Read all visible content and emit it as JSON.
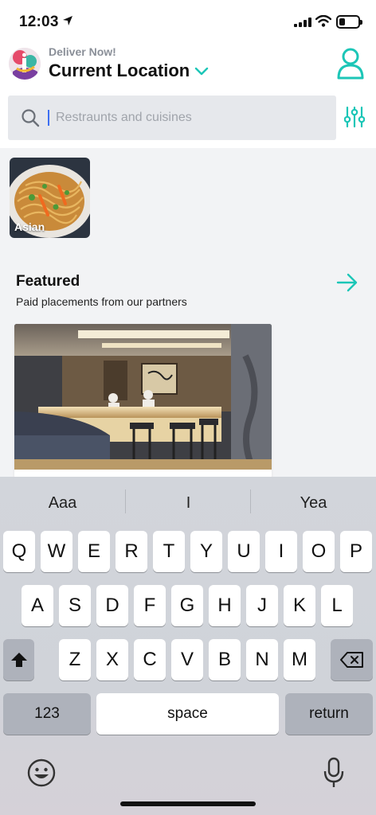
{
  "status": {
    "time": "12:03",
    "battery_level": 0.3
  },
  "header": {
    "deliver_label": "Deliver Now!",
    "location_title": "Current Location"
  },
  "search": {
    "placeholder": "Restraunts and cuisines",
    "value": ""
  },
  "categories": [
    {
      "label": "Asian"
    }
  ],
  "featured": {
    "title": "Featured",
    "subtitle": "Paid placements from our partners"
  },
  "keyboard": {
    "suggestions": [
      "Aaa",
      "I",
      "Yea"
    ],
    "row1": [
      "Q",
      "W",
      "E",
      "R",
      "T",
      "Y",
      "U",
      "I",
      "O",
      "P"
    ],
    "row2": [
      "A",
      "S",
      "D",
      "F",
      "G",
      "H",
      "J",
      "K",
      "L"
    ],
    "row3": [
      "Z",
      "X",
      "C",
      "V",
      "B",
      "N",
      "M"
    ],
    "numbers_label": "123",
    "space_label": "space",
    "return_label": "return"
  },
  "colors": {
    "accent": "#1cc6b7",
    "caret": "#3d6ff2"
  }
}
